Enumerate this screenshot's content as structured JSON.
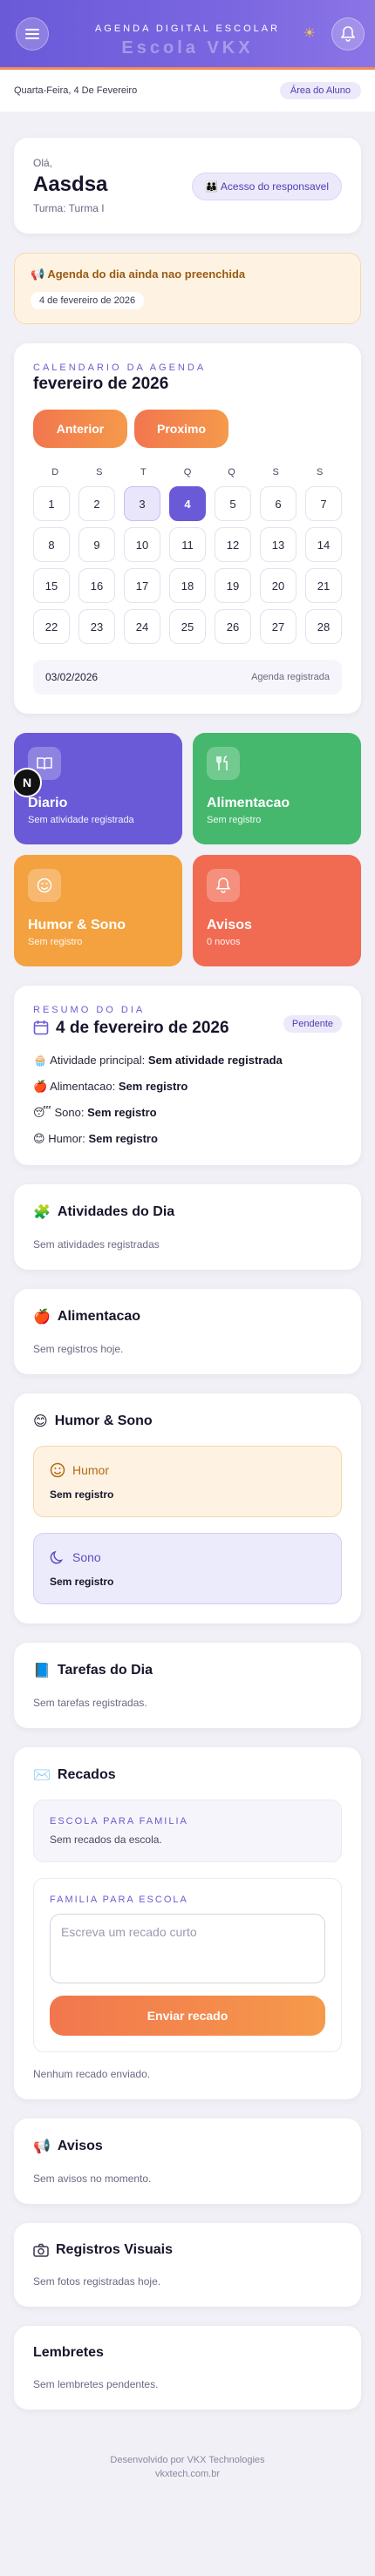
{
  "header": {
    "title": "AGENDA DIGITAL ESCOLAR",
    "subtitle": "Escola VKX",
    "menu_icon": "menu-icon",
    "theme_icon": "sun-icon",
    "notif_icon": "bell-icon"
  },
  "datebar": {
    "date_text": "Quarta-Feira, 4 De Fevereiro",
    "area_label": "Área do Aluno"
  },
  "profile": {
    "greeting": "Olá,",
    "name": "Aasdsa",
    "turma": "Turma: Turma I",
    "responsavel_label": "👪 Acesso do responsavel"
  },
  "alert": {
    "title": "📢 Agenda do dia ainda nao preenchida",
    "date": "4 de fevereiro de 2026"
  },
  "calendar": {
    "eyebrow": "CALENDARIO DA AGENDA",
    "month": "fevereiro de 2026",
    "prev_label": "Anterior",
    "next_label": "Proximo",
    "weekdays": [
      "D",
      "S",
      "T",
      "Q",
      "Q",
      "S",
      "S"
    ],
    "days": [
      "1",
      "2",
      "3",
      "4",
      "5",
      "6",
      "7",
      "8",
      "9",
      "10",
      "11",
      "12",
      "13",
      "14",
      "15",
      "16",
      "17",
      "18",
      "19",
      "20",
      "21",
      "22",
      "23",
      "24",
      "25",
      "26",
      "27",
      "28"
    ],
    "date_value": "03/02/2026",
    "status": "Agenda registrada"
  },
  "tiles": [
    {
      "title": "Diario",
      "sub": "Sem atividade registrada",
      "icon": "book-icon"
    },
    {
      "title": "Alimentacao",
      "sub": "Sem registro",
      "icon": "utensils-icon"
    },
    {
      "title": "Humor & Sono",
      "sub": "Sem registro",
      "icon": "smile-icon"
    },
    {
      "title": "Avisos",
      "sub": "0 novos",
      "icon": "bell-icon"
    }
  ],
  "floating_badge": "N",
  "resumo": {
    "eyebrow": "RESUMO DO DIA",
    "title": "4 de fevereiro de 2026",
    "status": "Pendente",
    "rows": [
      {
        "emoji": "🧁",
        "label": "Atividade principal:",
        "value": "Sem atividade registrada"
      },
      {
        "emoji": "🍎",
        "label": "Alimentacao:",
        "value": "Sem registro"
      },
      {
        "emoji": "😴",
        "label": "Sono:",
        "value": "Sem registro"
      },
      {
        "emoji": "😊",
        "label": "Humor:",
        "value": "Sem registro"
      }
    ]
  },
  "atividades": {
    "emoji": "🧩",
    "title": "Atividades do Dia",
    "text": "Sem atividades registradas"
  },
  "alimentacao": {
    "emoji": "🍎",
    "title": "Alimentacao",
    "text": "Sem registros hoje."
  },
  "humor_sono": {
    "emoji": "😊",
    "title": "Humor & Sono",
    "humor_label": "Humor",
    "humor_value": "Sem registro",
    "sono_label": "Sono",
    "sono_value": "Sem registro"
  },
  "tarefas": {
    "emoji": "📘",
    "title": "Tarefas do Dia",
    "text": "Sem tarefas registradas."
  },
  "recados": {
    "emoji": "✉️",
    "title": "Recados",
    "escola_eyebrow": "ESCOLA PARA FAMILIA",
    "escola_text": "Sem recados da escola.",
    "familia_eyebrow": "FAMILIA PARA ESCOLA",
    "placeholder": "Escreva um recado curto",
    "send_label": "Enviar recado",
    "footer_text": "Nenhum recado enviado."
  },
  "avisos": {
    "emoji": "📢",
    "title": "Avisos",
    "text": "Sem avisos no momento."
  },
  "registros": {
    "title": "Registros Visuais",
    "text": "Sem fotos registradas hoje."
  },
  "lembretes": {
    "title": "Lembretes",
    "text": "Sem lembretes pendentes."
  },
  "footer": {
    "line1": "Desenvolvido por VKX Technologies",
    "line2": "vkxtech.com.br"
  },
  "colors": {
    "primary": "#6a5ad8",
    "accent": "#f2764e",
    "green": "#45b86d",
    "orange": "#f3a23f",
    "coral": "#f06b52"
  }
}
